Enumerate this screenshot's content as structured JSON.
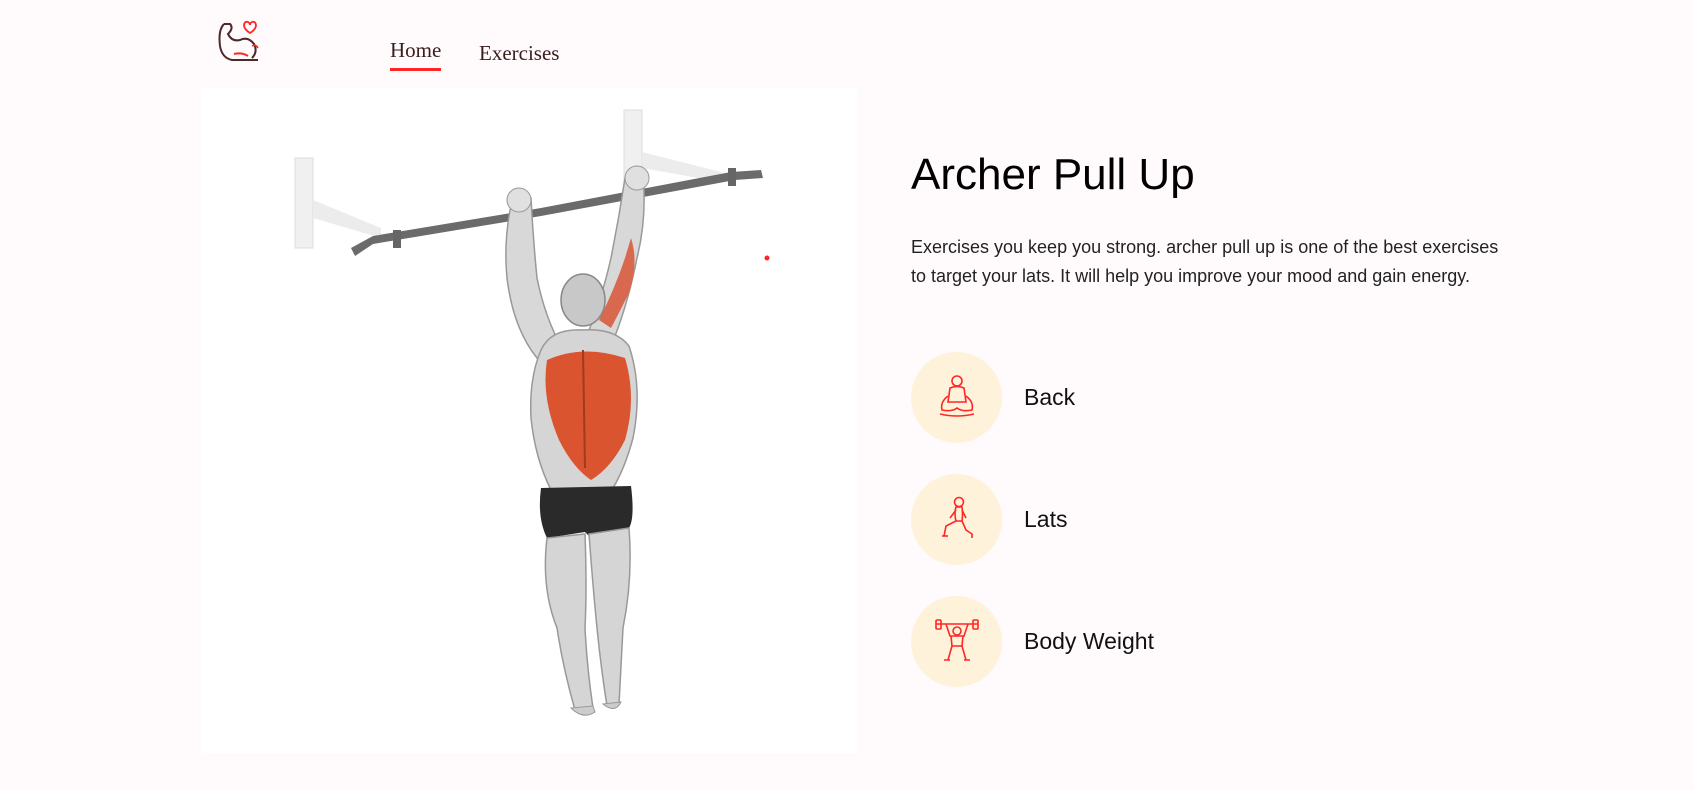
{
  "nav": {
    "logo": "gym-logo-icon",
    "items": [
      {
        "label": "Home",
        "active": true
      },
      {
        "label": "Exercises",
        "active": false
      }
    ],
    "accent_color": "#ff2625"
  },
  "exercise": {
    "image": "archer-pull-up-illustration",
    "name": "Archer Pull Up",
    "description": "Exercises you keep you strong. archer pull up is one of the best exercises to target your lats. It will help you improve your mood and gain energy.",
    "details": [
      {
        "label": "Back",
        "icon": "body-part-icon"
      },
      {
        "label": "Lats",
        "icon": "target-icon"
      },
      {
        "label": "Body Weight",
        "icon": "equipment-icon"
      }
    ],
    "icon_bg_color": "#fff2db"
  }
}
